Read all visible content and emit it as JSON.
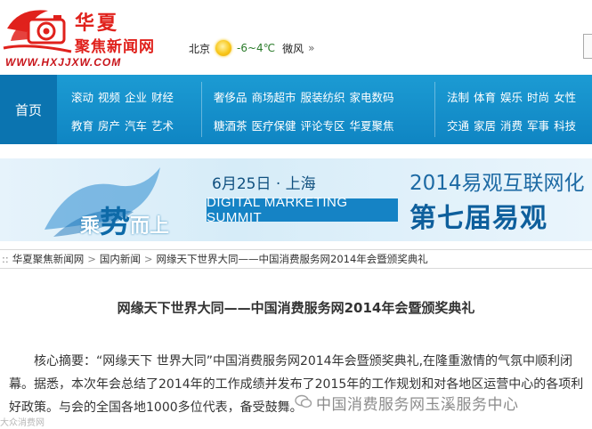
{
  "header": {
    "logo_cn_top": "华夏",
    "logo_cn_bottom": "聚焦新闻网",
    "logo_url": "WWW.HXJJXW.COM",
    "weather": {
      "city": "北京",
      "temp": "-6~4℃",
      "wind": "微风",
      "arrow": "»"
    }
  },
  "nav": {
    "home": "首页",
    "groups": [
      {
        "row1": [
          "滚动",
          "视频",
          "企业",
          "财经"
        ],
        "row2": [
          "教育",
          "房产",
          "汽车",
          "艺术"
        ]
      },
      {
        "row1": [
          "奢侈品",
          "商场超市",
          "服装纺织",
          "家电数码"
        ],
        "row2": [
          "糖酒茶",
          "医疗保健",
          "评论专区",
          "华夏聚焦"
        ]
      },
      {
        "row1": [
          "法制",
          "体育",
          "娱乐",
          "时尚",
          "女性"
        ],
        "row2": [
          "交通",
          "家居",
          "消费",
          "军事",
          "科技"
        ]
      }
    ]
  },
  "banner": {
    "slogan_pre": "乘",
    "slogan_big": "势",
    "slogan_post": "而上",
    "date": "6月25日 · 上海",
    "summit": "DIGITAL MARKETING SUMMIT",
    "title1": "2014易观互联网化",
    "title2": "第七届易观"
  },
  "breadcrumb": {
    "items": [
      "华夏聚焦新闻网",
      "国内新闻",
      "网缘天下世界大同——中国消费服务网2014年会暨颁奖典礼"
    ],
    "sep": ">"
  },
  "article": {
    "title": "网缘天下世界大同——中国消费服务网2014年会暨颁奖典礼",
    "summary": "核心摘要：“网缘天下 世界大同”中国消费服务网2014年会暨颁奖典礼,在隆重激情的气氛中顺利闭幕。据悉，本次年会总结了2014年的工作成绩并发布了2015年的工作规划和对各地区运营中心的各项利好政策。与会的全国各地1000多位代表，备受鼓舞。"
  },
  "watermark": {
    "text": "中国消费服务网玉溪服务中心",
    "small": "大众消费网"
  },
  "colors": {
    "nav_bg": "#1591cc",
    "brand_red": "#e0211c",
    "banner_blue": "#1583c5"
  }
}
